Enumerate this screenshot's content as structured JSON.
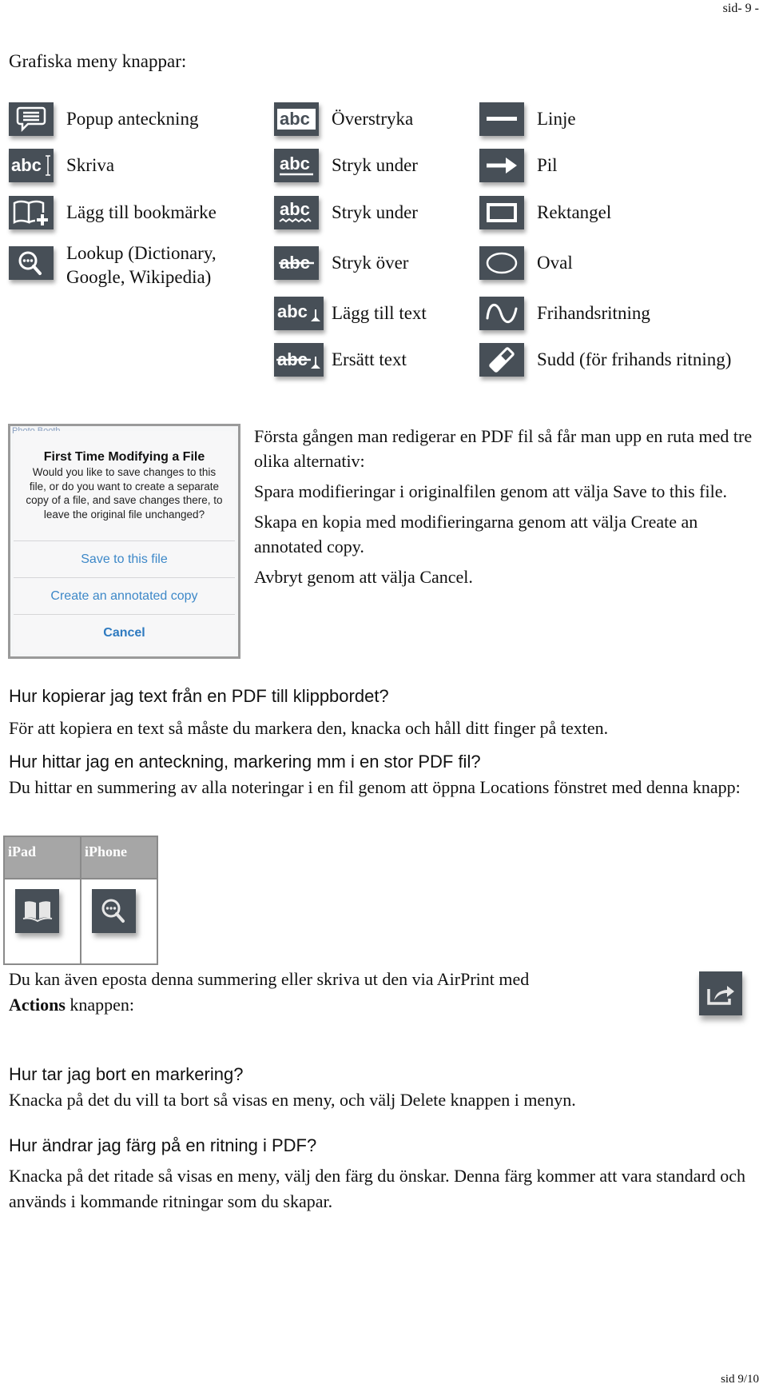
{
  "header": {
    "page_label": "sid- 9 -"
  },
  "footer": {
    "page_label": "sid 9/10"
  },
  "menu_section": {
    "title": "Grafiska meny knappar:",
    "columns": [
      [
        {
          "icon": "popup-note-icon",
          "label": "Popup anteckning"
        },
        {
          "icon": "typewriter-icon",
          "label": "Skriva"
        },
        {
          "icon": "add-bookmark-icon",
          "label": "Lägg till bookmärke"
        },
        {
          "icon": "lookup-icon",
          "label": "Lookup (Dictionary,\nGoogle, Wikipedia)"
        }
      ],
      [
        {
          "icon": "highlight-icon",
          "label": "Överstryka"
        },
        {
          "icon": "underline-icon",
          "label": "Stryk under"
        },
        {
          "icon": "squiggly-underline-icon",
          "label": "Stryk under"
        },
        {
          "icon": "strikethrough-icon",
          "label": "Stryk över"
        },
        {
          "icon": "insert-text-icon",
          "label": "Lägg till text"
        },
        {
          "icon": "replace-text-icon",
          "label": "Ersätt text"
        }
      ],
      [
        {
          "icon": "line-icon",
          "label": "Linje"
        },
        {
          "icon": "arrow-icon",
          "label": "Pil"
        },
        {
          "icon": "rectangle-icon",
          "label": "Rektangel"
        },
        {
          "icon": "oval-icon",
          "label": "Oval"
        },
        {
          "icon": "freehand-icon",
          "label": "Frihandsritning"
        },
        {
          "icon": "eraser-icon",
          "label": "Sudd (för frihands ritning)"
        }
      ]
    ]
  },
  "dialog_screenshot": {
    "background_text": "Photo Booth",
    "title": "First Time Modifying a File",
    "message": "Would you like to save changes to this file, or do you want to create a separate copy of a file, and save changes there, to leave the original file unchanged?",
    "buttons": [
      "Save to this file",
      "Create an annotated copy",
      "Cancel"
    ],
    "accent_color": "#3d88c8"
  },
  "dialog_description": [
    "Första gången man redigerar en PDF fil så får man upp en ruta med tre olika alternativ:",
    "Spara modifieringar i originalfilen genom att välja Save to this file.",
    "Skapa en kopia med modifieringarna genom att välja Create an annotated copy.",
    "Avbryt genom att välja Cancel."
  ],
  "faq": [
    {
      "question": "Hur kopierar jag text från en PDF till klippbordet?",
      "answer": "För att kopiera en text så måste du markera den, knacka och håll ditt finger på texten."
    },
    {
      "question": "Hur hittar jag en anteckning, markering mm i en stor PDF fil?",
      "answer": "Du hittar en summering av alla noteringar i en fil genom att öppna Locations fönstret med denna knapp:"
    },
    {
      "question": "Hur tar jag bort en markering?",
      "answer": "Knacka på det du vill ta bort så visas en meny, och välj Delete knappen i menyn."
    },
    {
      "question": "Hur ändrar jag färg på en ritning i PDF?",
      "answer": "Knacka på det ritade så visas en meny, välj den färg du önskar. Denna färg kommer att vara standard och används i kommande ritningar som du skapar."
    }
  ],
  "locations_table": {
    "headers": [
      "iPad",
      "iPhone"
    ],
    "icons": [
      "book-icon",
      "lookup-icon"
    ]
  },
  "actions_note": {
    "text_before": "Du kan även eposta denna summering eller skriva ut den via AirPrint med",
    "bold": "Actions",
    "text_after": " knappen:",
    "icon": "share-icon"
  },
  "colors": {
    "icon_bg": "#474f57",
    "table_header_bg": "#a6a6a6"
  }
}
